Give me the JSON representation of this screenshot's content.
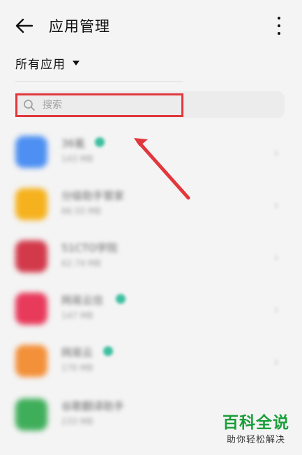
{
  "header": {
    "title": "应用管理",
    "back_icon": "back-arrow-icon",
    "more_icon": "more-vertical-icon"
  },
  "filter": {
    "label": "所有应用",
    "icon": "caret-down-icon"
  },
  "search": {
    "placeholder": "搜索",
    "icon": "search-icon",
    "highlight_color": "#e2373c"
  },
  "apps": [
    {
      "name": "36氪",
      "size": "143 MB",
      "icon_color": "#4d8ff2"
    },
    {
      "name": "分级助手管家",
      "size": "66.55 MB",
      "icon_color": "#f6b21e"
    },
    {
      "name": "51CTO学院",
      "size": "62.74 MB",
      "icon_color": "#d23a4a"
    },
    {
      "name": "网易云信",
      "size": "147 MB",
      "icon_color": "#e83a5b"
    },
    {
      "name": "网易云",
      "size": "170 MB",
      "icon_color": "#f3903a"
    },
    {
      "name": "谷歌翻译助手",
      "size": "233 MB",
      "icon_color": "#3fae5a"
    }
  ],
  "watermark": {
    "title": "百科全说",
    "subtitle": "助你轻松解决",
    "color": "#1a9e3a"
  }
}
